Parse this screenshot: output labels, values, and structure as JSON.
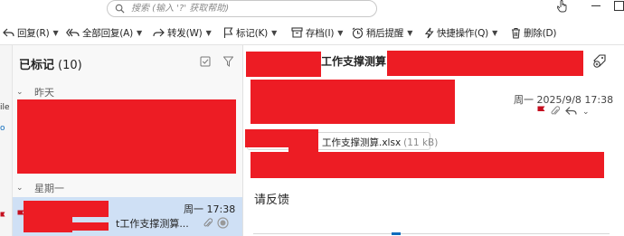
{
  "search": {
    "placeholder": "搜索 (输入 '?' 获取帮助)"
  },
  "toolbar": {
    "reply": "回复(R)",
    "reply_all": "全部回复(A)",
    "forward": "转发(W)",
    "flag": "标记(K)",
    "archive": "存档(I)",
    "snooze": "稍后提醒",
    "quick_actions": "快捷操作(Q)",
    "delete": "删除(D)"
  },
  "left_strip": {
    "frag1": "ile",
    "frag2": "o"
  },
  "message_list": {
    "title": "已标记",
    "count": "(10)",
    "groups": [
      {
        "label": "昨天"
      },
      {
        "label": "星期一"
      }
    ],
    "items": [
      {
        "time": "周一 17:38",
        "subject": "t工作支撑测算..."
      }
    ]
  },
  "reading_pane": {
    "subject": "工作支撑测算",
    "date": "周一 2025/9/8 17:38",
    "attachment": {
      "name": "工作支撑测算.xlsx",
      "size": "(11 kB)"
    },
    "body": "请反馈"
  },
  "colors": {
    "accent": "#0f6cbd",
    "flag": "#c50f1f",
    "selected": "#cfe0f5",
    "redaction": "#ed1c24"
  },
  "icons": [
    "search-icon",
    "hand-cursor-icon",
    "reply-icon",
    "reply-all-icon",
    "forward-icon",
    "flag-icon",
    "archive-icon",
    "snooze-icon",
    "quick-action-icon",
    "delete-icon",
    "select-all-icon",
    "filter-icon",
    "chevron-down-icon",
    "paperclip-icon",
    "tag-icon"
  ]
}
